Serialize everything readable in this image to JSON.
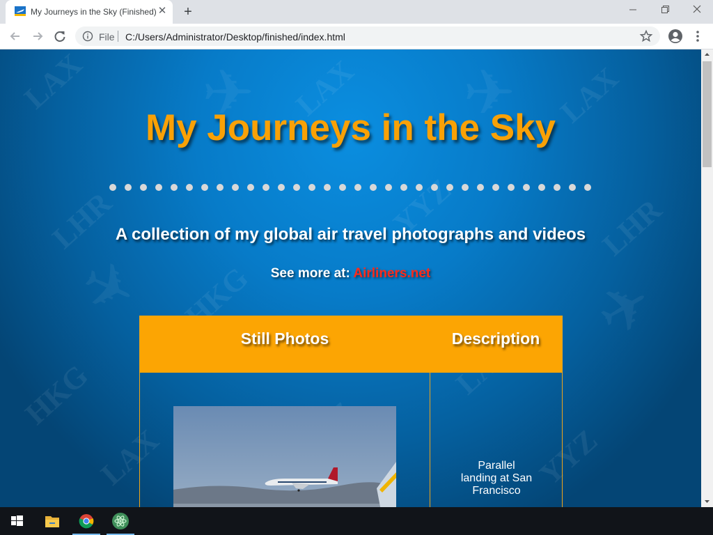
{
  "browser": {
    "tab_title": "My Journeys in the Sky (Finished)",
    "tab_close_glyph": "✕",
    "new_tab_glyph": "+",
    "scheme_label": "File",
    "url": "C:/Users/Administrator/Desktop/finished/index.html",
    "icons": [
      "back-icon",
      "forward-icon",
      "reload-icon",
      "info-icon",
      "star-icon",
      "profile-icon",
      "menu-icon",
      "minimize-icon",
      "maximize-icon",
      "close-icon"
    ]
  },
  "page": {
    "title": "My Journeys in the Sky",
    "subtitle": "A collection of my global air travel photographs and videos",
    "see_more_label": "See more at:",
    "see_more_link": "Airliners.net",
    "watermarks": [
      "LAX",
      "LAX",
      "LHR",
      "HKG",
      "YYZ",
      "LAX",
      "LHR",
      "HKG",
      "YYZ",
      "LAX",
      "YYZ",
      "LAX"
    ],
    "table": {
      "headers": [
        "Still Photos",
        "Description"
      ],
      "rows": [
        {
          "photo_subject": "airliner-landing-photo",
          "description": "Parallel landing at San Francisco"
        }
      ]
    }
  },
  "taskbar": {
    "items": [
      "windows-start-icon",
      "file-explorer-icon",
      "chrome-icon",
      "atom-icon"
    ]
  },
  "colors": {
    "title_orange": "#f9a106",
    "header_orange": "#fca503",
    "link_red": "#ff2a1a",
    "page_blue": "#077bc8",
    "dot_grey": "#d8d8d8"
  }
}
